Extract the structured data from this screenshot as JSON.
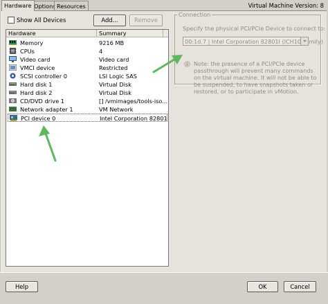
{
  "tabs": [
    {
      "label": "Hardware",
      "active": true
    },
    {
      "label": "Options",
      "active": false
    },
    {
      "label": "Resources",
      "active": false
    }
  ],
  "vm_version": "Virtual Machine Version: 8",
  "show_all_devices": {
    "label": "Show All Devices",
    "checked": false
  },
  "buttons": {
    "add": "Add...",
    "remove": "Remove",
    "help": "Help",
    "ok": "OK",
    "cancel": "Cancel"
  },
  "hardware_list": {
    "columns": [
      "Hardware",
      "Summary"
    ],
    "rows": [
      {
        "icon": "memory-icon",
        "hardware": "Memory",
        "summary": "9216 MB"
      },
      {
        "icon": "cpu-icon",
        "hardware": "CPUs",
        "summary": "4"
      },
      {
        "icon": "video-card-icon",
        "hardware": "Video card",
        "summary": "Video card"
      },
      {
        "icon": "vmci-icon",
        "hardware": "VMCI device",
        "summary": "Restricted"
      },
      {
        "icon": "scsi-icon",
        "hardware": "SCSI controller 0",
        "summary": "LSI Logic SAS"
      },
      {
        "icon": "hard-disk-icon",
        "hardware": "Hard disk 1",
        "summary": "Virtual Disk"
      },
      {
        "icon": "hard-disk-icon",
        "hardware": "Hard disk 2",
        "summary": "Virtual Disk"
      },
      {
        "icon": "cd-dvd-icon",
        "hardware": "CD/DVD drive 1",
        "summary": "[] /vmimages/tools-iso..."
      },
      {
        "icon": "network-adapter-icon",
        "hardware": "Network adapter 1",
        "summary": "VM Network"
      },
      {
        "icon": "pci-device-icon",
        "hardware": "PCI device 0",
        "summary": "Intel Corporation 82801..."
      }
    ],
    "selected_index": 9
  },
  "connection": {
    "title": "Connection",
    "prompt": "Specify the physical PCI/PCIe Device to connect to:",
    "selected_device": "00:1d.7 | Intel Corporation 82801I (ICH10 Family)"
  },
  "note": "Note: the presence of a PCI/PCIe device passthrough will prevent many commands on the virtual machine. It will not be able to be suspended, to have snapshots taken or restored, or to participate in vMotion.",
  "colors": {
    "annotation_arrow": "#5cb85c",
    "window_bg": "#d4d0c8",
    "panel_bg": "#e6e3dd",
    "disabled_text": "#8f8c85"
  }
}
